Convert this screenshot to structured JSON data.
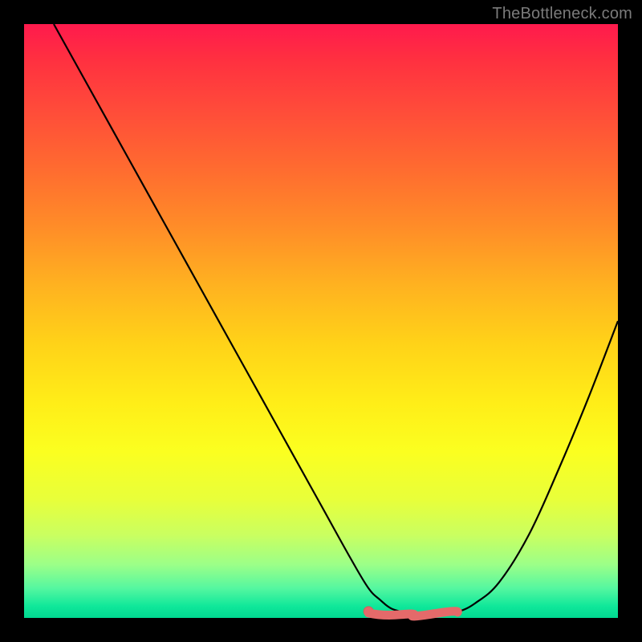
{
  "watermark": "TheBottleneck.com",
  "colors": {
    "background": "#000000",
    "curve": "#000000",
    "marker_fill": "#e46a6a",
    "marker_stroke": "#d75a5a"
  },
  "chart_data": {
    "type": "line",
    "title": "",
    "xlabel": "",
    "ylabel": "",
    "xlim": [
      0,
      100
    ],
    "ylim": [
      0,
      100
    ],
    "grid": false,
    "legend": false,
    "x": [
      5,
      10,
      15,
      20,
      25,
      30,
      35,
      40,
      45,
      50,
      55,
      58,
      60,
      62,
      65,
      68,
      70,
      73,
      76,
      80,
      85,
      90,
      95,
      100
    ],
    "values": [
      100,
      91,
      82,
      73,
      64,
      55,
      46,
      37,
      28,
      19,
      10,
      5,
      3,
      1.5,
      0.8,
      0.5,
      0.5,
      1,
      2.5,
      6,
      14,
      25,
      37,
      50
    ],
    "flat_region": {
      "x_start": 58,
      "x_end": 73,
      "y": 0.7
    },
    "series_name": "bottleneck-curve"
  }
}
